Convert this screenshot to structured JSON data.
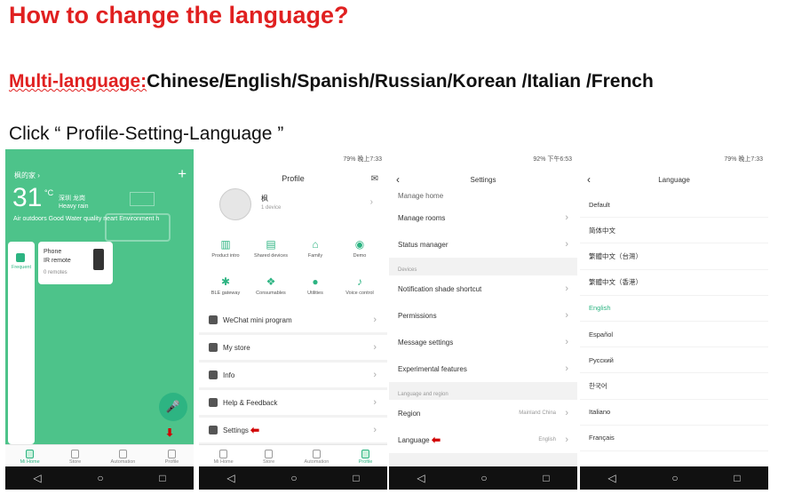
{
  "heading": "How to change the language?",
  "multi": {
    "label": "Multi-language:",
    "list": "Chinese/English/Spanish/Russian/Korean /Italian /French"
  },
  "instruction": "Click “ Profile-Setting-Language ”",
  "status": {
    "p2_time": "79% 晚上7:33",
    "p3_time": "92% 下午6:53",
    "p4_time": "79% 晚上7:33"
  },
  "bottom_tabs": [
    "Mi Home",
    "Store",
    "Automation",
    "Profile"
  ],
  "phone1": {
    "home_name": "枫的家 ›",
    "temp": "31",
    "degree": "°C",
    "location": "深圳 龙岗",
    "weather": "Heavy rain",
    "air": "Air outdoors Good  Water quality neart  Environment h",
    "frequent": "Frequent",
    "device_name": "Phone",
    "device_type": "IR remote",
    "remotes": "0 remotes"
  },
  "phone2": {
    "title": "Profile",
    "user_name": "枫",
    "devices": "1 device",
    "grid": [
      "Product intro",
      "Shared devices",
      "Family",
      "Demo",
      "BLE gateway",
      "Consumables",
      "Utilities",
      "Voice control"
    ],
    "menu": [
      "WeChat mini program",
      "My store",
      "Info",
      "Help & Feedback",
      "Settings"
    ]
  },
  "phone3": {
    "title": "Settings",
    "top_item": "Manage home",
    "items1": [
      "Manage rooms",
      "Status manager"
    ],
    "section_devices": "Devices",
    "items2": [
      "Notification shade shortcut",
      "Permissions",
      "Message settings",
      "Experimental features"
    ],
    "section_lang": "Language and region",
    "region_label": "Region",
    "region_value": "Mainland China",
    "language_label": "Language",
    "language_value": "English"
  },
  "phone4": {
    "title": "Language",
    "languages": [
      "Default",
      "简体中文",
      "繁體中文（台灣）",
      "繁體中文（香港）",
      "English",
      "Español",
      "Русский",
      "한국어",
      "Italiano",
      "Français"
    ],
    "selected": "English"
  },
  "colors": {
    "accent": "#2db482",
    "heading_red": "#e02020",
    "arrow_red": "#d10000"
  }
}
